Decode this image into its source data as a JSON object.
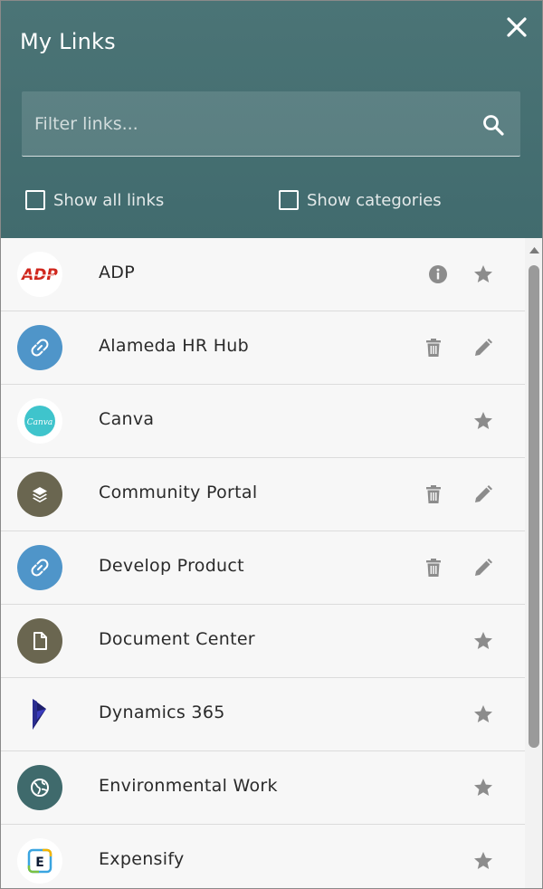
{
  "header": {
    "title": "My Links",
    "close_icon": "close-icon"
  },
  "search": {
    "placeholder": "Filter links...",
    "value": "",
    "icon": "search-icon"
  },
  "options": {
    "show_all_links": {
      "label": "Show all links",
      "checked": false
    },
    "show_categories": {
      "label": "Show categories",
      "checked": false
    }
  },
  "links": [
    {
      "name": "ADP",
      "logo": "adp-logo",
      "actions": [
        "info-icon",
        "star-icon"
      ]
    },
    {
      "name": "Alameda HR Hub",
      "logo": "link-icon",
      "actions": [
        "trash-icon",
        "pencil-icon"
      ]
    },
    {
      "name": "Canva",
      "logo": "canva-logo",
      "actions": [
        "star-icon"
      ]
    },
    {
      "name": "Community Portal",
      "logo": "layers-icon",
      "actions": [
        "trash-icon",
        "pencil-icon"
      ]
    },
    {
      "name": "Develop Product",
      "logo": "link-icon",
      "actions": [
        "trash-icon",
        "pencil-icon"
      ]
    },
    {
      "name": "Document Center",
      "logo": "document-icon",
      "actions": [
        "star-icon"
      ]
    },
    {
      "name": "Dynamics 365",
      "logo": "dynamics-logo",
      "actions": [
        "star-icon"
      ]
    },
    {
      "name": "Environmental Work",
      "logo": "globe-icon",
      "actions": [
        "star-icon"
      ]
    },
    {
      "name": "Expensify",
      "logo": "expensify-logo",
      "actions": [
        "star-icon"
      ]
    }
  ],
  "logo_text": {
    "adp": "ADP",
    "canva": "Canva",
    "expensify": "E"
  },
  "colors": {
    "header": "#467072",
    "link_blue": "#4f95c9",
    "olive": "#6a6650",
    "env_teal": "#3f6a6c",
    "icon_gray": "#8c8c8c"
  }
}
